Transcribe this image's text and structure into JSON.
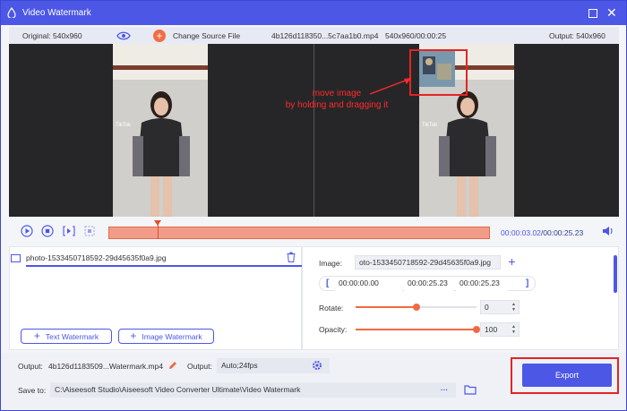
{
  "window": {
    "title": "Video Watermark"
  },
  "infobar": {
    "original": "Original: 540x960",
    "change_source": "Change Source File",
    "file_info": "4b126d118350...5c7aa1b0.mp4",
    "res_duration": "540x960/00:00:25",
    "output": "Output: 540x960"
  },
  "preview": {
    "annotation_line1": "move image",
    "annotation_line2": "by holding and dragging it",
    "tiktok_tag": "TikTok"
  },
  "playback": {
    "current_time": "00:00:03.02",
    "total_time": "/00:00:25.23",
    "progress": 0.13
  },
  "watermark_list": {
    "items": [
      {
        "name": "photo-1533450718592-29d45635f0a9.jpg"
      }
    ],
    "add_text_label": "Text Watermark",
    "add_image_label": "Image Watermark"
  },
  "settings": {
    "image_label": "Image:",
    "image_value": "oto-1533450718592-29d45635f0a9.jpg",
    "range_start": "00:00:00.00",
    "range_end": "00:00:25.23",
    "range_third": "00:00:25.23",
    "rotate_label": "Rotate:",
    "rotate_value": "0",
    "rotate_level": 0.5,
    "opacity_label": "Opacity:",
    "opacity_value": "100",
    "opacity_level": 1.0
  },
  "output_bar": {
    "output_label": "Output:",
    "output_file": "4b126d1183509...Watermark.mp4",
    "format_label": "Output:",
    "format_value": "Auto;24fps",
    "save_label": "Save to:",
    "save_path": "C:\\Aiseesoft Studio\\Aiseesoft Video Converter Ultimate\\Video Watermark",
    "more": "···",
    "export_label": "Export"
  },
  "colors": {
    "accent": "#4c57e6",
    "timeline": "#f29b88",
    "highlight": "#e32424",
    "slider": "#f06a43"
  }
}
